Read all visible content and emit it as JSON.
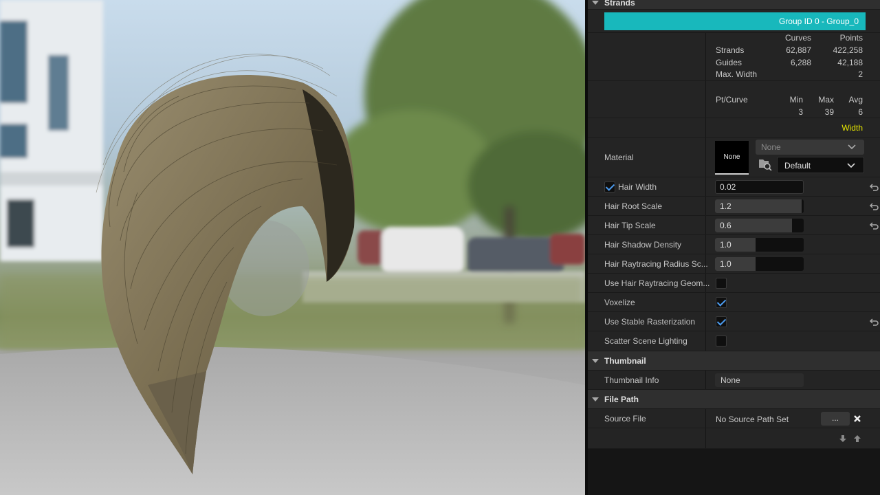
{
  "viewport": {
    "scene": "hair-groom-preview"
  },
  "panel": {
    "strands_section": {
      "title": "Strands"
    },
    "group_bar": {
      "label": "Group ID 0 - Group_0",
      "color": "#18b8bc"
    },
    "stats": {
      "headers": {
        "curves": "Curves",
        "points": "Points"
      },
      "rows": [
        {
          "label": "Strands",
          "curves": "62,887",
          "points": "422,258"
        },
        {
          "label": "Guides",
          "curves": "6,288",
          "points": "42,188"
        },
        {
          "label": "Max. Width",
          "curves": "",
          "points": "2"
        }
      ],
      "pt_curve": {
        "label": "Pt/Curve",
        "min_label": "Min",
        "max_label": "Max",
        "avg_label": "Avg",
        "min": "3",
        "max": "39",
        "avg": "6"
      },
      "width_link": {
        "label": "Width",
        "color": "#e6e600"
      }
    },
    "material": {
      "label": "Material",
      "thumb_text": "None",
      "dropdown_value": "None",
      "slot_value": "Default"
    },
    "properties": [
      {
        "label": "Hair Width",
        "value": "0.02",
        "has_checkbox": true,
        "checked": true,
        "reset": true
      },
      {
        "label": "Hair Root Scale",
        "value": "1.2",
        "fill": 0.98,
        "reset": true
      },
      {
        "label": "Hair Tip Scale",
        "value": "0.6",
        "fill": 0.87,
        "reset": true
      },
      {
        "label": "Hair Shadow Density",
        "value": "1.0",
        "fill": 0.46
      },
      {
        "label": "Hair Raytracing Radius Sc...",
        "value": "1.0",
        "fill": 0.46
      }
    ],
    "toggles": [
      {
        "label": "Use Hair Raytracing Geom...",
        "checked": false
      },
      {
        "label": "Voxelize",
        "checked": true
      },
      {
        "label": "Use Stable Rasterization",
        "checked": true,
        "reset": true
      },
      {
        "label": "Scatter Scene Lighting",
        "checked": false
      }
    ],
    "thumbnail_section": {
      "title": "Thumbnail"
    },
    "thumbnail_info": {
      "label": "Thumbnail Info",
      "value": "None"
    },
    "file_path_section": {
      "title": "File Path"
    },
    "source_file": {
      "label": "Source File",
      "value": "No Source Path Set",
      "browse_label": "..."
    }
  }
}
